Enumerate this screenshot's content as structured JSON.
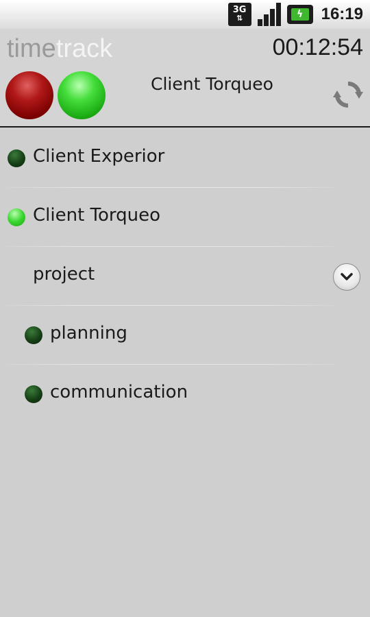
{
  "status_bar": {
    "network": "3G",
    "time": "16:19",
    "icons": [
      "3g-icon",
      "signal-icon",
      "battery-charging-icon"
    ]
  },
  "header": {
    "logo_part1": "time",
    "logo_part2": "track",
    "timer": "00:12:54",
    "current_client": "Client Torqueo",
    "colors": {
      "stop": "#a01010",
      "start": "#33cc2a",
      "logo_gray": "#9a9a9a",
      "logo_white": "#f4f4f4"
    }
  },
  "list": {
    "items": [
      {
        "label": "Client Experior",
        "indicator": "inactive"
      },
      {
        "label": "Client Torqueo",
        "indicator": "active"
      },
      {
        "label": "project",
        "expandable": true
      },
      {
        "label": "planning",
        "indicator": "inactive"
      },
      {
        "label": "communication",
        "indicator": "inactive"
      }
    ]
  }
}
